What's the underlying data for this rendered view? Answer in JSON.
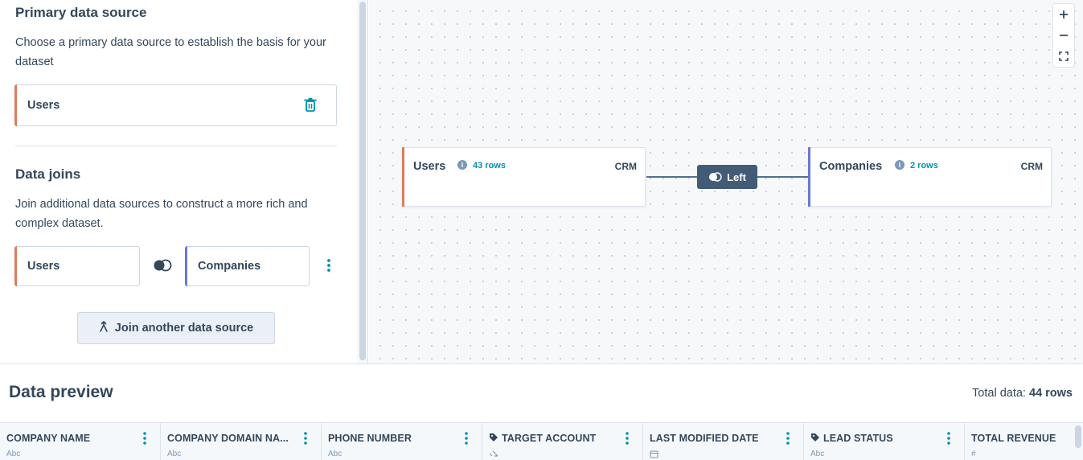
{
  "colors": {
    "users_accent": "#e07a5f",
    "companies_accent": "#6a78d1",
    "link_teal": "#0091ae",
    "join_pill": "#425b76"
  },
  "primary": {
    "title": "Primary data source",
    "description": "Choose a primary data source to establish the basis for your dataset",
    "source_label": "Users",
    "delete_icon": "trash-icon"
  },
  "joins": {
    "title": "Data joins",
    "description": "Join additional data sources to construct a more rich and complex dataset.",
    "left_source": "Users",
    "right_source": "Companies",
    "join_type_icon": "left-join-icon",
    "join_button_label": "Join another data source"
  },
  "canvas": {
    "zoom_in": "+",
    "zoom_out": "−",
    "join_label": "Left",
    "nodes": [
      {
        "title": "Users",
        "rows": "43 rows",
        "source": "CRM"
      },
      {
        "title": "Companies",
        "rows": "2 rows",
        "source": "CRM"
      }
    ]
  },
  "preview": {
    "title": "Data preview",
    "total_label": "Total data:",
    "total_value": "44 rows",
    "columns": [
      {
        "name": "COMPANY NAME",
        "type": "Abc"
      },
      {
        "name": "COMPANY DOMAIN NA...",
        "type": "Abc"
      },
      {
        "name": "PHONE NUMBER",
        "type": "Abc"
      },
      {
        "name": "TARGET ACCOUNT",
        "type": "boolean"
      },
      {
        "name": "LAST MODIFIED DATE",
        "type": "date"
      },
      {
        "name": "LEAD STATUS",
        "type": "Abc"
      },
      {
        "name": "TOTAL REVENUE",
        "type": "#"
      }
    ]
  }
}
